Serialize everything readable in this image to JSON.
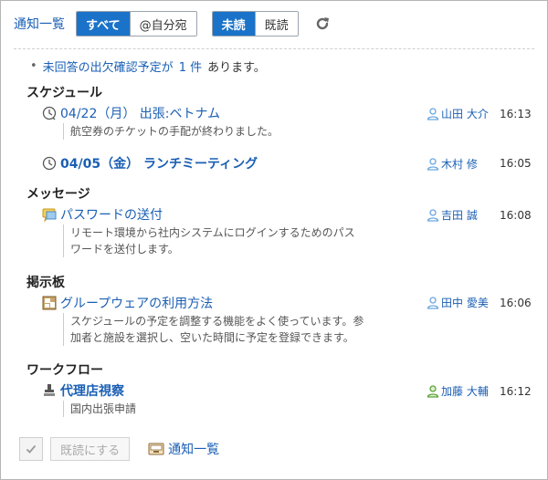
{
  "header": {
    "title": "通知一覧",
    "filter_all": "すべて",
    "filter_mine": "@自分宛",
    "unread": "未読",
    "read": "既読"
  },
  "notice": {
    "text1": "未回答の出欠確認予定が",
    "count": "1 件",
    "text2": "あります。"
  },
  "sections": {
    "schedule": "スケジュール",
    "message": "メッセージ",
    "board": "掲示板",
    "workflow": "ワークフロー"
  },
  "items": [
    {
      "title": "04/22（月） 出張:ベトナム",
      "body": "航空券のチケットの手配が終わりました。",
      "user": "山田 大介",
      "time": "16:13"
    },
    {
      "title": "04/05（金） ランチミーティング",
      "body": "",
      "user": "木村 修",
      "time": "16:05"
    },
    {
      "title": "パスワードの送付",
      "body1": "リモート環境から社内システムにログインするためのパス",
      "body2": "ワードを送付します。",
      "user": "吉田 誠",
      "time": "16:08"
    },
    {
      "title": "グループウェアの利用方法",
      "body1": "スケジュールの予定を調整する機能をよく使っています。参",
      "body2": "加者と施設を選択し、空いた時間に予定を登録できます。",
      "user": "田中 愛美",
      "time": "16:06"
    },
    {
      "title": "代理店視察",
      "body": "国内出張申請",
      "user": "加藤 大輔",
      "time": "16:12"
    }
  ],
  "footer": {
    "mark_read": "既読にする",
    "list_link": "通知一覧"
  },
  "colors": {
    "accent": "#1a73c8",
    "link": "#1a5fb4",
    "user_blue": "#6aa6e0",
    "user_green": "#5aa33a"
  }
}
